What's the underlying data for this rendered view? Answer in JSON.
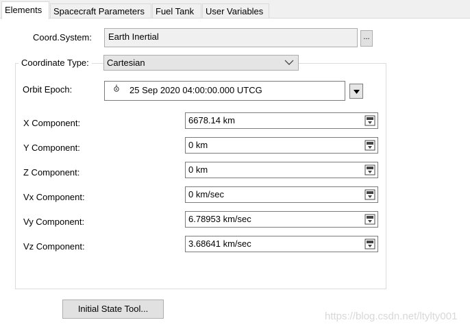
{
  "tabs": [
    {
      "label": "Elements",
      "active": true
    },
    {
      "label": "Spacecraft Parameters",
      "active": false
    },
    {
      "label": "Fuel Tank",
      "active": false
    },
    {
      "label": "User Variables",
      "active": false
    }
  ],
  "coord_system": {
    "label": "Coord.System:",
    "value": "Earth Inertial",
    "browse_label": "..."
  },
  "coordinate_type": {
    "label": "Coordinate Type:",
    "value": "Cartesian"
  },
  "orbit_epoch": {
    "label": "Orbit Epoch:",
    "value": "25 Sep 2020 04:00:00.000 UTCG"
  },
  "components": [
    {
      "label": "X Component:",
      "value": "6678.14 km"
    },
    {
      "label": "Y Component:",
      "value": "0 km"
    },
    {
      "label": "Z Component:",
      "value": "0 km"
    },
    {
      "label": "Vx Component:",
      "value": "0 km/sec"
    },
    {
      "label": "Vy Component:",
      "value": "6.78953 km/sec"
    },
    {
      "label": "Vz Component:",
      "value": "3.68641 km/sec"
    }
  ],
  "initial_state_button": "Initial State Tool...",
  "watermark": "https://blog.csdn.net/ltylty001",
  "colors": {
    "tab_bg": "#f0f0f0",
    "readonly_bg": "#f0f0f0",
    "button_bg": "#e1e1e1",
    "group_border": "#dcdcdc"
  },
  "icons": {
    "epoch": "satellite-epoch-icon",
    "field": "unit-calculator-icon",
    "dropdown": "chevron-down-icon"
  }
}
